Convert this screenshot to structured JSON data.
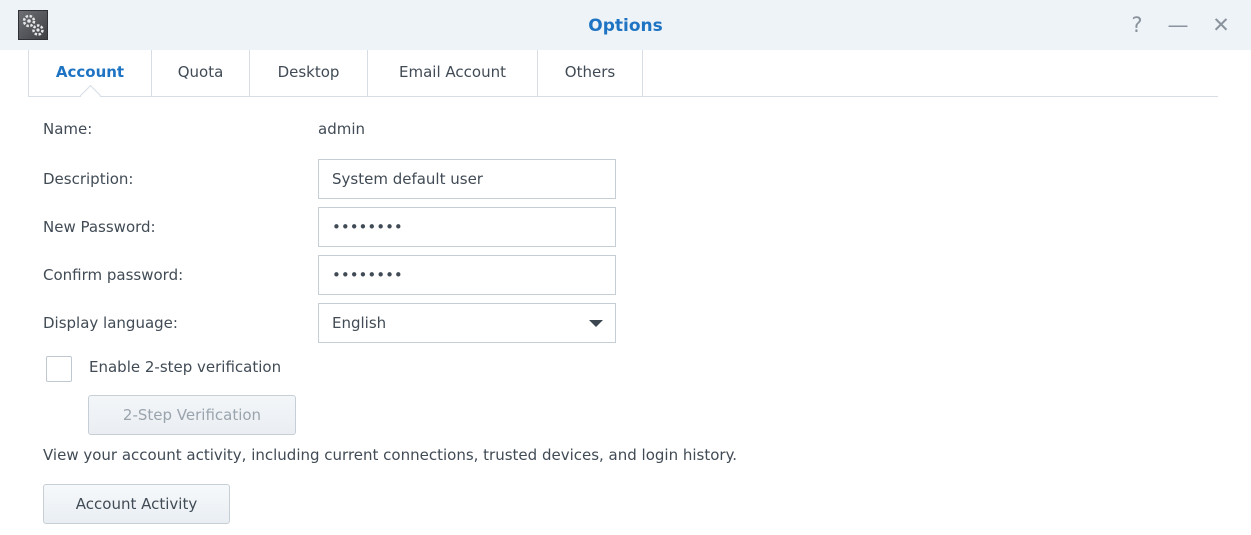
{
  "window": {
    "title": "Options",
    "app_icon": "gears-icon",
    "help_glyph": "?",
    "minimize_glyph": "—",
    "close_glyph": "✕"
  },
  "tabs": [
    {
      "label": "Account",
      "active": true
    },
    {
      "label": "Quota",
      "active": false
    },
    {
      "label": "Desktop",
      "active": false
    },
    {
      "label": "Email Account",
      "active": false
    },
    {
      "label": "Others",
      "active": false
    }
  ],
  "form": {
    "name_label": "Name:",
    "name_value": "admin",
    "description_label": "Description:",
    "description_value": "System default user",
    "new_password_label": "New Password:",
    "new_password_value": "••••••••",
    "confirm_password_label": "Confirm password:",
    "confirm_password_value": "••••••••",
    "display_language_label": "Display language:",
    "display_language_value": "English",
    "two_step_label": "Enable 2-step verification",
    "two_step_checked": false,
    "two_step_button": "2-Step Verification",
    "activity_text": "View your account activity, including current connections, trusted devices, and login history.",
    "activity_button": "Account Activity"
  },
  "colors": {
    "accent": "#1e74c3",
    "titlebar_bg": "#eef3f8",
    "text": "#414b55"
  }
}
